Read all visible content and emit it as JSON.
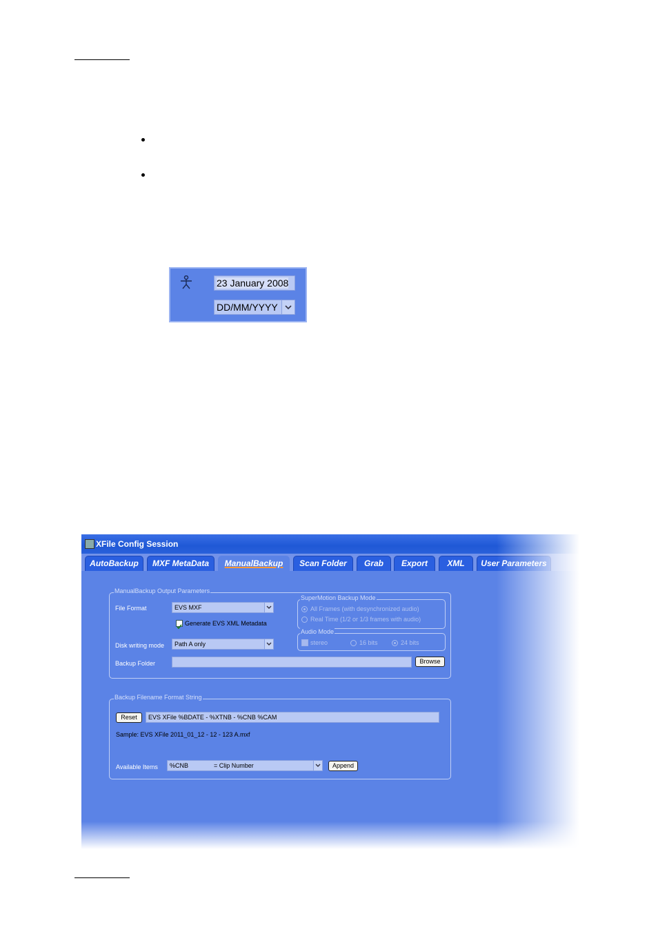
{
  "date_widget": {
    "date_value": "23 January 2008",
    "format_value": "DD/MM/YYYY"
  },
  "window": {
    "title": "XFile Config Session",
    "tabs": [
      {
        "label": "AutoBackup"
      },
      {
        "label": "MXF MetaData"
      },
      {
        "label": "ManualBackup"
      },
      {
        "label": "Scan Folder"
      },
      {
        "label": "Grab"
      },
      {
        "label": "Export"
      },
      {
        "label": "XML"
      },
      {
        "label": "User Parameters"
      }
    ],
    "active_tab": "ManualBackup",
    "output_group": {
      "legend": "ManualBackup Output Parameters",
      "file_format_label": "File Format",
      "file_format_value": "EVS MXF",
      "generate_xml_label": "Generate EVS XML Metadata",
      "disk_mode_label": "Disk writing mode",
      "disk_mode_value": "Path A only",
      "backup_folder_label": "Backup Folder",
      "backup_folder_value": "",
      "browse_label": "Browse"
    },
    "supermotion_group": {
      "legend": "SuperMotion Backup Mode",
      "option_all": "All Frames (with desynchronized audio)",
      "option_realtime": "Real Time (1/2 or 1/3 frames with audio)"
    },
    "audio_group": {
      "legend": "Audio Mode",
      "stereo_label": "stereo",
      "bits16_label": "16 bits",
      "bits24_label": "24 bits"
    },
    "filename_group": {
      "legend": "Backup Filename Format String",
      "reset_label": "Reset",
      "format_string": "EVS XFile %BDATE - %XTNB - %CNB %CAM",
      "sample_text": "Sample: EVS XFile 2011_01_12 - 12 - 123 A.mxf",
      "available_items_label": "Available Items",
      "available_item_code": "%CNB",
      "available_item_desc": "= Clip Number",
      "append_label": "Append"
    }
  },
  "colors": {
    "panel_blue": "#5b83e6",
    "titlebar_blue": "#1f58d6",
    "tab_blue": "#2a5fe0",
    "active_underline": "#ff9933"
  }
}
